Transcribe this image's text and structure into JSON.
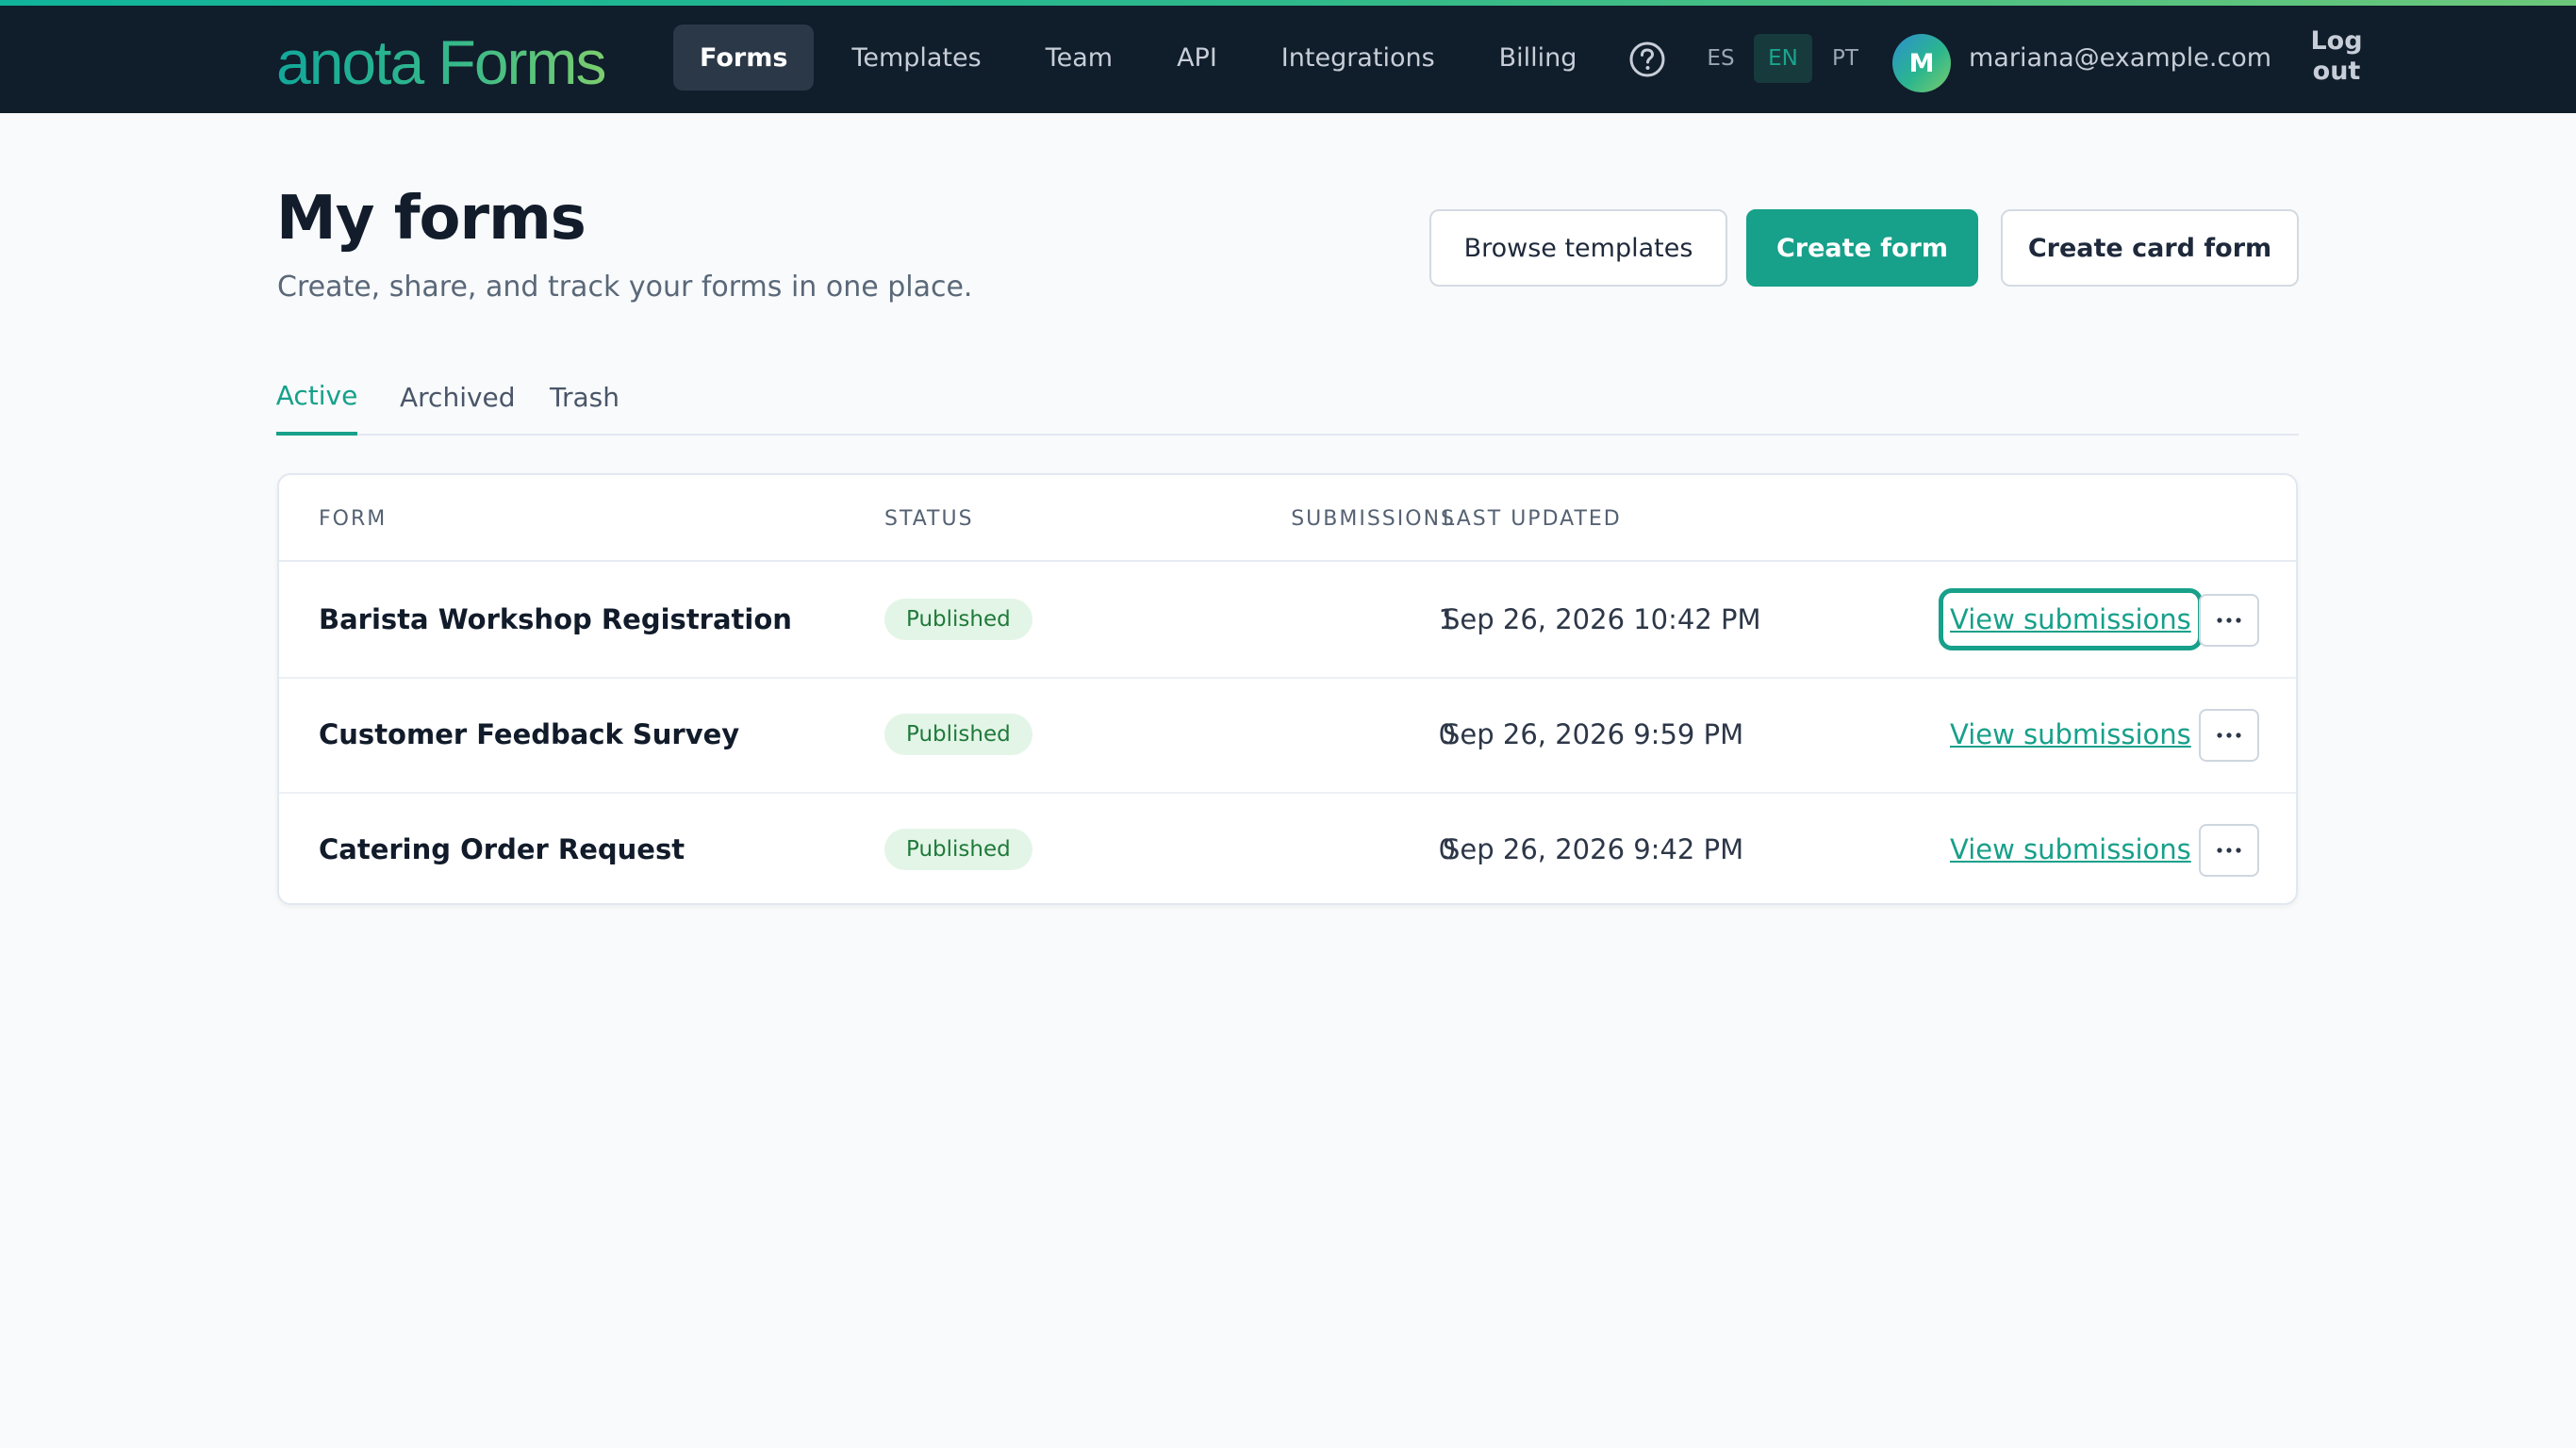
{
  "header": {
    "logo_text": "anota Forms",
    "nav": [
      {
        "label": "Forms",
        "active": true
      },
      {
        "label": "Templates",
        "active": false
      },
      {
        "label": "Team",
        "active": false
      },
      {
        "label": "API",
        "active": false
      },
      {
        "label": "Integrations",
        "active": false
      },
      {
        "label": "Billing",
        "active": false
      }
    ],
    "help_icon": "question-circle-icon",
    "languages": [
      "ES",
      "EN",
      "PT"
    ],
    "active_language": "EN",
    "avatar_initial": "M",
    "user_email": "mariana@example.com",
    "logout_label": "Log out"
  },
  "page": {
    "title": "My forms",
    "subtitle": "Create, share, and track your forms in one place."
  },
  "actions": {
    "browse_templates": "Browse templates",
    "create_form": "Create form",
    "create_card_form": "Create card form"
  },
  "tabs": [
    {
      "label": "Active",
      "active": true
    },
    {
      "label": "Archived",
      "active": false
    },
    {
      "label": "Trash",
      "active": false
    }
  ],
  "table": {
    "columns": [
      "FORM",
      "STATUS",
      "SUBMISSIONS",
      "LAST UPDATED"
    ],
    "view_label": "View submissions",
    "more_icon": "ellipsis-icon",
    "rows": [
      {
        "name": "Barista Workshop Registration",
        "status": "Published",
        "submissions": "1",
        "updated": "Sep 26, 2026 10:42 PM",
        "focused": true
      },
      {
        "name": "Customer Feedback Survey",
        "status": "Published",
        "submissions": "0",
        "updated": "Sep 26, 2026 9:59 PM",
        "focused": false
      },
      {
        "name": "Catering Order Request",
        "status": "Published",
        "submissions": "0",
        "updated": "Sep 26, 2026 9:42 PM",
        "focused": false
      }
    ]
  },
  "colors": {
    "accent": "#17a08a",
    "nav_background": "#101d2b",
    "badge_background": "#e3f5e7",
    "badge_text": "#1f7a3a"
  }
}
